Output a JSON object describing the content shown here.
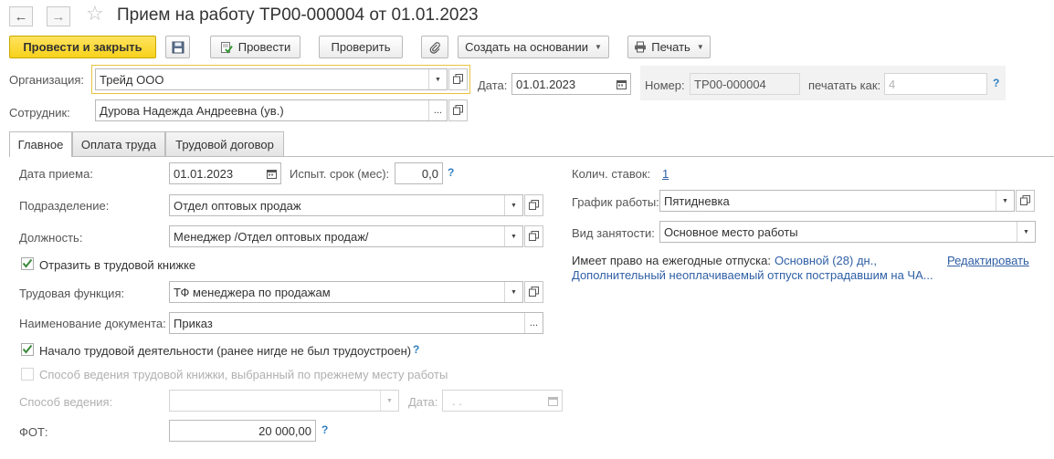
{
  "window": {
    "title": "Прием на работу ТР00-000004 от 01.01.2023",
    "back_glyph": "←",
    "forward_glyph": "→",
    "star_glyph": "☆"
  },
  "toolbar": {
    "post_close": "Провести и закрыть",
    "post": "Провести",
    "check": "Проверить",
    "create_based": "Создать на основании",
    "print": "Печать"
  },
  "header": {
    "org_label": "Организация:",
    "org_value": "Трейд ООО",
    "date_label": "Дата:",
    "date_value": "01.01.2023",
    "number_label": "Номер:",
    "number_value": "ТР00-000004",
    "print_as_label": "печатать как:",
    "print_as_value": "4",
    "employee_label": "Сотрудник:",
    "employee_value": "Дурова Надежда Андреевна (ув.)"
  },
  "tabs": [
    {
      "label": "Главное"
    },
    {
      "label": "Оплата труда"
    },
    {
      "label": "Трудовой договор"
    }
  ],
  "main": {
    "hire_date_label": "Дата приема:",
    "hire_date_value": "01.01.2023",
    "probation_label": "Испыт. срок (мес):",
    "probation_value": "0,0",
    "department_label": "Подразделение:",
    "department_value": "Отдел оптовых продаж",
    "position_label": "Должность:",
    "position_value": "Менеджер /Отдел оптовых продаж/",
    "workbook_checkbox": "Отразить в трудовой книжке",
    "labor_function_label": "Трудовая функция:",
    "labor_function_value": "ТФ менеджера по продажам",
    "doc_name_label": "Наименование документа:",
    "doc_name_value": "Приказ",
    "career_start_checkbox": "Начало трудовой деятельности (ранее нигде не был трудоустроен)",
    "prev_method_checkbox": "Способ ведения трудовой книжки, выбранный по прежнему месту работы",
    "method_label": "Способ ведения:",
    "method_value": "",
    "method_date_label": "Дата:",
    "method_date_value": ". .",
    "fot_label": "ФОТ:",
    "fot_value": "20 000,00",
    "rates_label": "Колич. ставок:",
    "rates_value": "1",
    "schedule_label": "График работы:",
    "schedule_value": "Пятидневка",
    "employment_label": "Вид занятости:",
    "employment_value": "Основное место работы",
    "vacation_label": "Имеет право на ежегодные отпуска:",
    "vacation_main": "Основной (28) дн.,",
    "vacation_extra": "Дополнительный неоплачиваемый отпуск пострадавшим на ЧА...",
    "edit_link": "Редактировать"
  },
  "help_glyph": "?",
  "ellipsis": "...",
  "colors": {
    "accent_yellow": "#f7d21b",
    "link_blue": "#2f5fa5",
    "help_blue": "#2f7fc1",
    "check_green": "#3a8a3a"
  }
}
